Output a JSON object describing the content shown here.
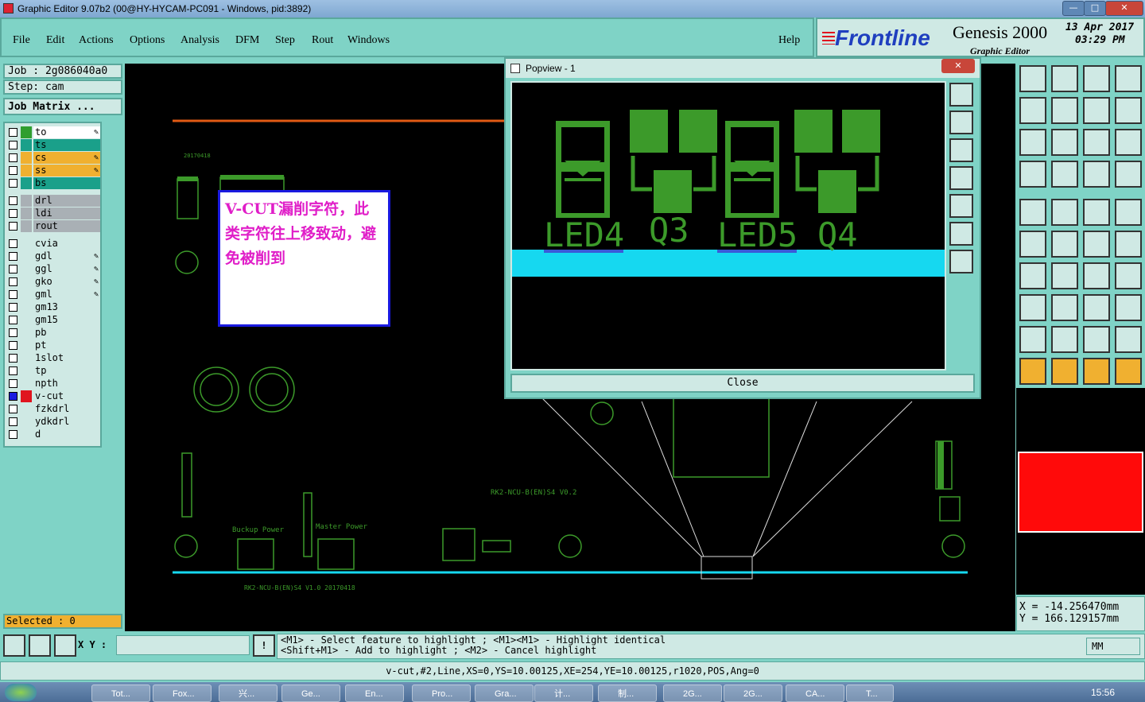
{
  "window": {
    "title": "Graphic Editor 9.07b2 (00@HY-HYCAM-PC091 - Windows, pid:3892)",
    "min": "—",
    "max": "□",
    "close": "✕"
  },
  "menu": {
    "items": [
      "File",
      "Edit",
      "Actions",
      "Options",
      "Analysis",
      "DFM",
      "Step",
      "Rout",
      "Windows"
    ],
    "help": "Help"
  },
  "brand": {
    "logo": "Frontline",
    "product": "Genesis 2000",
    "subtitle": "Graphic Editor",
    "date": "13 Apr 2017",
    "time": "03:29 PM"
  },
  "job": {
    "job_label": "Job : 2g086040a0",
    "step_label": "Step: cam",
    "matrix_button": "Job Matrix ..."
  },
  "layers": [
    {
      "name": "to",
      "bg": "#ffffff",
      "sw": "#2f9e2f",
      "edit": true
    },
    {
      "name": "ts",
      "bg": "#1aa08a",
      "sw": "#1aa08a",
      "edit": false
    },
    {
      "name": "cs",
      "bg": "#f0b030",
      "sw": "#f0b030",
      "edit": true
    },
    {
      "name": "ss",
      "bg": "#f0b030",
      "sw": "#f0b030",
      "edit": true
    },
    {
      "name": "bs",
      "bg": "#1aa08a",
      "sw": "#1aa08a",
      "edit": false
    },
    {
      "name": "drl",
      "bg": "#a9b0b5",
      "sw": "#a9b0b5",
      "edit": false
    },
    {
      "name": "ldi",
      "bg": "#a9b0b5",
      "sw": "#a9b0b5",
      "edit": false
    },
    {
      "name": "rout",
      "bg": "#a9b0b5",
      "sw": "#a9b0b5",
      "edit": false
    },
    {
      "name": "cvia",
      "bg": "#cfe9e4",
      "sw": "#cfe9e4",
      "edit": false
    },
    {
      "name": "gdl",
      "bg": "#cfe9e4",
      "sw": "#cfe9e4",
      "edit": true
    },
    {
      "name": "ggl",
      "bg": "#cfe9e4",
      "sw": "#cfe9e4",
      "edit": true
    },
    {
      "name": "gko",
      "bg": "#cfe9e4",
      "sw": "#cfe9e4",
      "edit": true
    },
    {
      "name": "gml",
      "bg": "#cfe9e4",
      "sw": "#cfe9e4",
      "edit": true
    },
    {
      "name": "gm13",
      "bg": "#cfe9e4",
      "sw": "#cfe9e4",
      "edit": false
    },
    {
      "name": "gm15",
      "bg": "#cfe9e4",
      "sw": "#cfe9e4",
      "edit": false
    },
    {
      "name": "pb",
      "bg": "#cfe9e4",
      "sw": "#cfe9e4",
      "edit": false
    },
    {
      "name": "pt",
      "bg": "#cfe9e4",
      "sw": "#cfe9e4",
      "edit": false
    },
    {
      "name": "1slot",
      "bg": "#cfe9e4",
      "sw": "#cfe9e4",
      "edit": false
    },
    {
      "name": "tp",
      "bg": "#cfe9e4",
      "sw": "#cfe9e4",
      "edit": false
    },
    {
      "name": "npth",
      "bg": "#cfe9e4",
      "sw": "#cfe9e4",
      "edit": false
    },
    {
      "name": "v-cut",
      "bg": "#cfe9e4",
      "sw": "#e0141e",
      "edit": false,
      "active": true
    },
    {
      "name": "fzkdrl",
      "bg": "#cfe9e4",
      "sw": "#cfe9e4",
      "edit": false
    },
    {
      "name": "ydkdrl",
      "bg": "#cfe9e4",
      "sw": "#cfe9e4",
      "edit": false
    },
    {
      "name": "d",
      "bg": "#cfe9e4",
      "sw": "#cfe9e4",
      "edit": false
    }
  ],
  "selected": "Selected : 0",
  "note": {
    "text": "V-CUT漏削字符，此类字符往上移致动，避免被削到"
  },
  "pcb_labels": {
    "board": "RK2-NCU-B(EN)S4 V0.2",
    "board2": "RK2-NCU-B(EN)S4 V1.0 20170418",
    "backup": "Buckup Power",
    "master": "Master Power",
    "date": "20170418"
  },
  "popview": {
    "title": "Popview - 1",
    "close_x": "✕",
    "labels": [
      "LED4",
      "Q3",
      "LED5",
      "Q4"
    ],
    "close_button": "Close"
  },
  "coords": {
    "x": "X = -14.256470mm",
    "y": "Y = 166.129157mm"
  },
  "xy_label": "X Y :",
  "xy_value": "",
  "messages": {
    "line1": "<M1> - Select feature to highlight ; <M1><M1> - Highlight identical",
    "line2": "<Shift+M1> - Add to highlight ; <M2> - Cancel highlight"
  },
  "units": "MM",
  "status": "v-cut,#2,Line,XS=0,YS=10.00125,XE=254,YE=10.00125,r1020,POS,Ang=0",
  "taskbar": {
    "items": [
      "Tot...",
      "Fox...",
      "兴...",
      "Ge...",
      "En...",
      "Pro...",
      "Gra...",
      "计...",
      "制...",
      "2G...",
      "2G...",
      "CA...",
      "T..."
    ],
    "clock": "15:56"
  },
  "colors": {
    "accent": "#7fd3c6",
    "panel": "#cfe9e4",
    "pcb_green": "#3c9a2a",
    "vcut": "#16d8f0",
    "note_text": "#e01ec8"
  }
}
